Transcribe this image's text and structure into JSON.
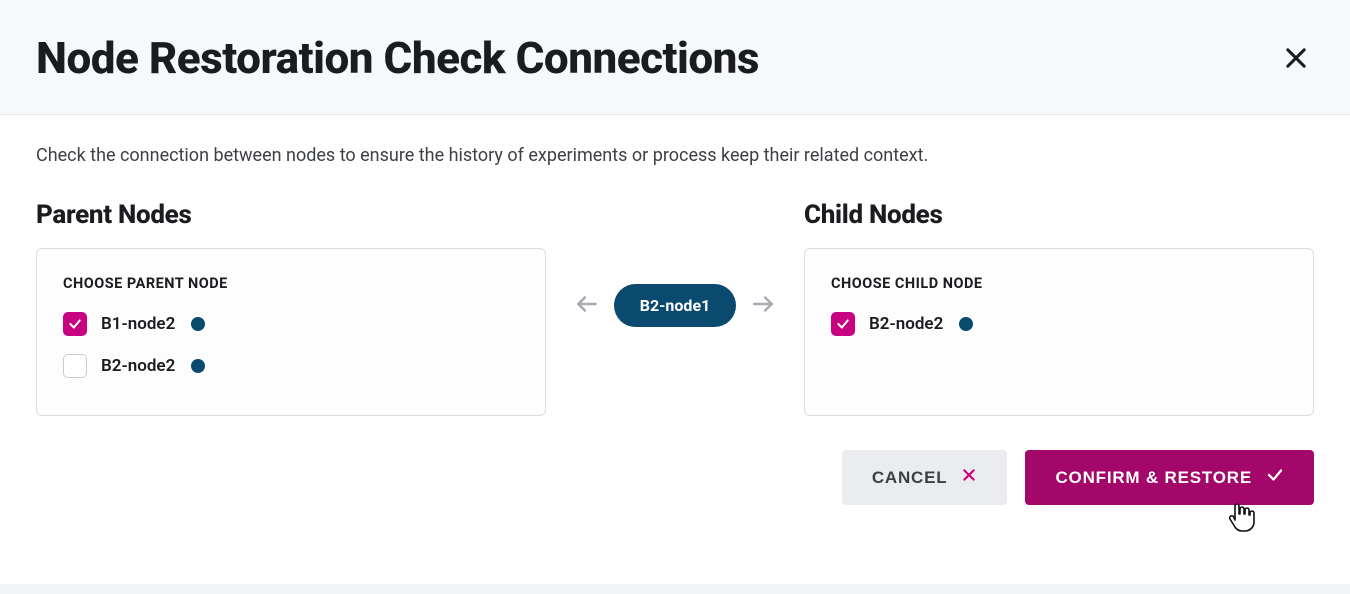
{
  "modal": {
    "title": "Node Restoration Check Connections",
    "description": "Check the connection between nodes to ensure the history of experiments or process keep their related context."
  },
  "parent": {
    "heading": "Parent Nodes",
    "box_label": "CHOOSE PARENT NODE",
    "items": [
      {
        "label": "B1-node2",
        "checked": true
      },
      {
        "label": "B2-node2",
        "checked": false
      }
    ]
  },
  "center": {
    "node": "B2-node1"
  },
  "child": {
    "heading": "Child Nodes",
    "box_label": "CHOOSE CHILD NODE",
    "items": [
      {
        "label": "B2-node2",
        "checked": true
      }
    ]
  },
  "footer": {
    "cancel": "CANCEL",
    "confirm": "CONFIRM & RESTORE"
  }
}
